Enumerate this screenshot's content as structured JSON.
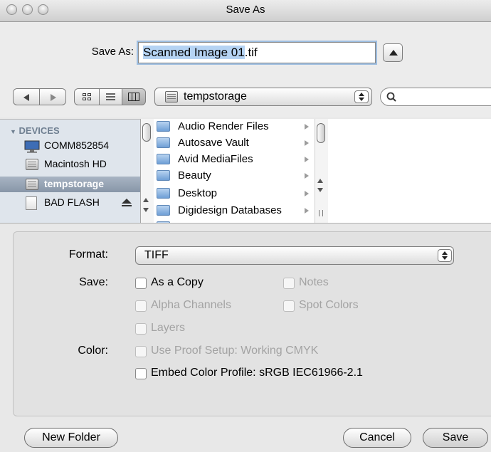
{
  "window": {
    "title": "Save As"
  },
  "save_as": {
    "label": "Save As:",
    "filename_selected": "Scanned Image 01",
    "filename_ext": ".tif"
  },
  "toolbar": {
    "location": "tempstorage",
    "search_placeholder": "",
    "icons": {
      "back": "back-arrow-icon",
      "forward": "forward-arrow-icon",
      "view_icons": "icon-view-icon",
      "view_list": "list-view-icon",
      "view_columns": "column-view-icon",
      "search": "magnifier-icon"
    }
  },
  "sidebar": {
    "heading": "DEVICES",
    "items": [
      {
        "label": "COMM852854",
        "icon": "computer-icon",
        "selected": false
      },
      {
        "label": "Macintosh HD",
        "icon": "hard-disk-icon",
        "selected": false
      },
      {
        "label": "tempstorage",
        "icon": "hard-disk-icon",
        "selected": true
      },
      {
        "label": "BAD FLASH",
        "icon": "flash-drive-icon",
        "selected": false,
        "eject": "eject-icon"
      }
    ]
  },
  "browser": {
    "items": [
      {
        "label": "Audio Render Files"
      },
      {
        "label": "Autosave Vault"
      },
      {
        "label": "Avid MediaFiles"
      },
      {
        "label": "Beauty"
      },
      {
        "label": "Desktop"
      },
      {
        "label": "Digidesign Databases"
      }
    ]
  },
  "options": {
    "format_label": "Format:",
    "format_value": "TIFF",
    "save_label": "Save:",
    "as_copy": "As a Copy",
    "notes": "Notes",
    "alpha": "Alpha Channels",
    "spot": "Spot Colors",
    "layers": "Layers",
    "color_label": "Color:",
    "proof": "Use Proof Setup:  Working CMYK",
    "embed": "Embed Color Profile:  sRGB IEC61966-2.1"
  },
  "buttons": {
    "new_folder": "New Folder",
    "cancel": "Cancel",
    "save": "Save"
  },
  "colors": {
    "selection": "#b5d3f3",
    "focus_ring": "#9dbde0",
    "sidebar_bg": "#dfe5ec",
    "sidebar_selected": "#8e9bad"
  }
}
